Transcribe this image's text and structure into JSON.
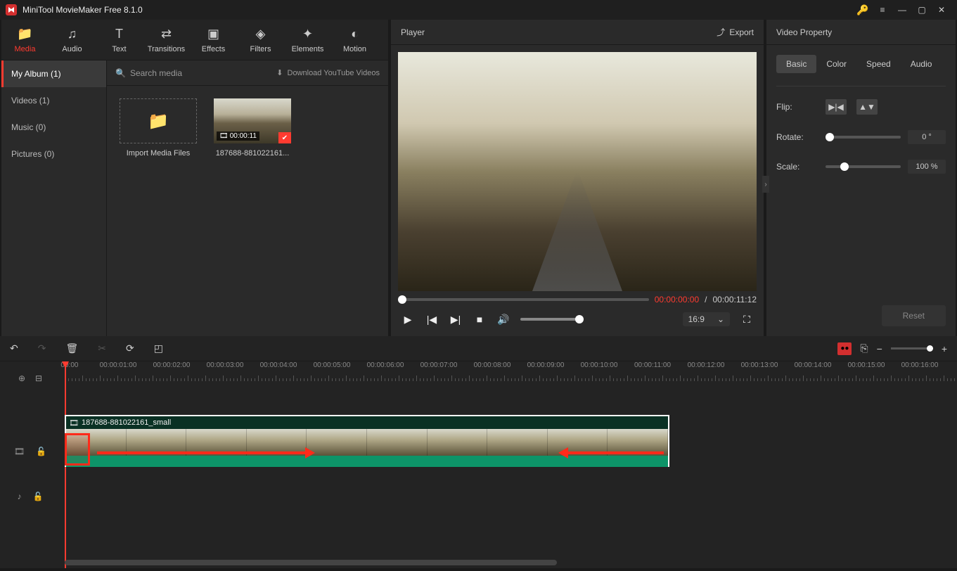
{
  "titlebar": {
    "title": "MiniTool MovieMaker Free 8.1.0"
  },
  "tabs": [
    {
      "label": "Media",
      "icon": "folder-icon",
      "active": true
    },
    {
      "label": "Audio",
      "icon": "music-icon"
    },
    {
      "label": "Text",
      "icon": "text-icon"
    },
    {
      "label": "Transitions",
      "icon": "transition-icon"
    },
    {
      "label": "Effects",
      "icon": "effects-icon"
    },
    {
      "label": "Filters",
      "icon": "filters-icon"
    },
    {
      "label": "Elements",
      "icon": "elements-icon"
    },
    {
      "label": "Motion",
      "icon": "motion-icon"
    }
  ],
  "albums": [
    {
      "label": "My Album (1)",
      "active": true
    },
    {
      "label": "Videos (1)"
    },
    {
      "label": "Music (0)"
    },
    {
      "label": "Pictures (0)"
    }
  ],
  "search": {
    "placeholder": "Search media",
    "download_label": "Download YouTube Videos"
  },
  "media_items": {
    "import_label": "Import Media Files",
    "clip_label": "187688-881022161...",
    "clip_duration": "00:00:11"
  },
  "player": {
    "title": "Player",
    "export_label": "Export",
    "current_time": "00:00:00:00",
    "total_time": "00:00:11:12",
    "aspect": "16:9"
  },
  "props": {
    "title": "Video Property",
    "tabs": [
      "Basic",
      "Color",
      "Speed",
      "Audio"
    ],
    "flip_label": "Flip:",
    "rotate_label": "Rotate:",
    "rotate_value": "0 °",
    "scale_label": "Scale:",
    "scale_value": "100 %",
    "reset_label": "Reset"
  },
  "timeline": {
    "clip_name": "187688-881022161_small",
    "ticks": [
      "00:00:00",
      "00:00:01:00",
      "00:00:02:00",
      "00:00:03:00",
      "00:00:04:00",
      "00:00:05:00",
      "00:00:06:00",
      "00:00:07:00",
      "00:00:08:00",
      "00:00:09:00",
      "00:00:10:00",
      "00:00:11:00",
      "00:00:12:00",
      "00:00:13:00",
      "00:00:14:00",
      "00:00:15:00",
      "00:00:16:00"
    ]
  }
}
